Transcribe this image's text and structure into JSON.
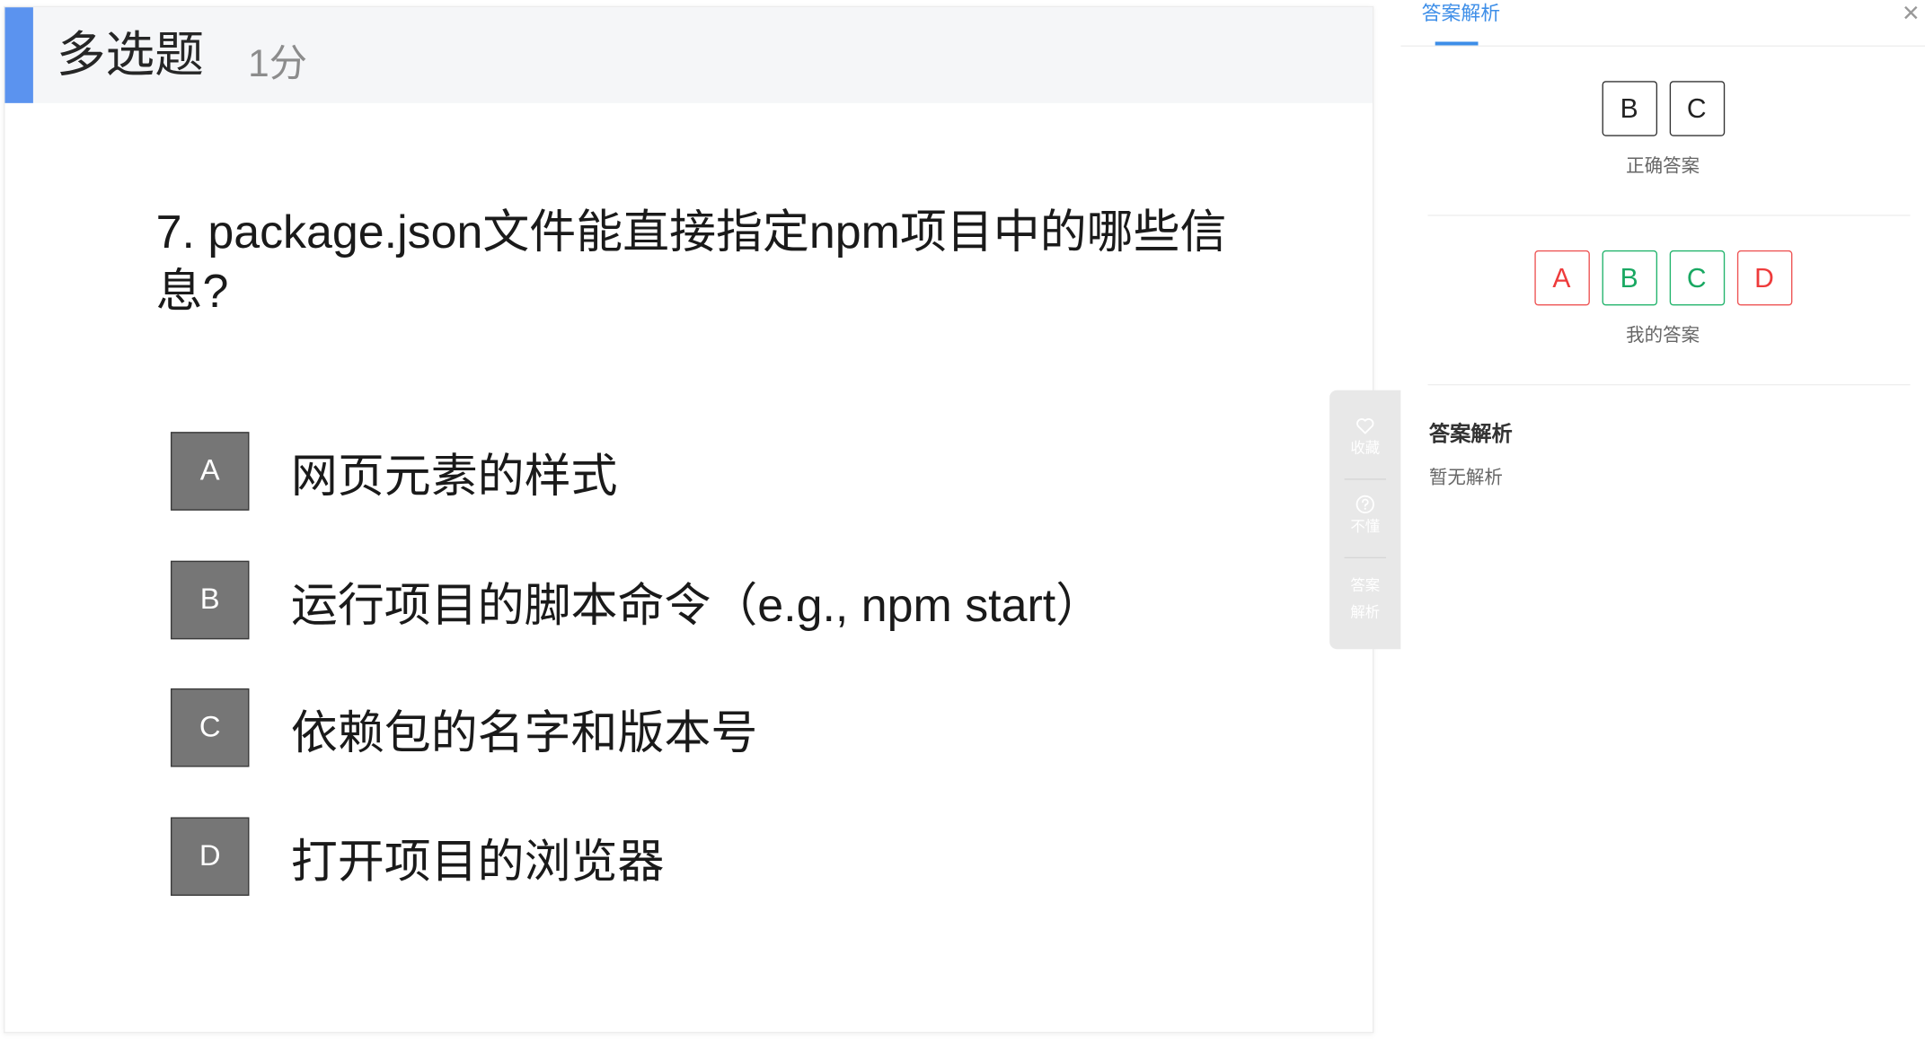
{
  "question": {
    "type_label": "多选题",
    "score": "1分",
    "stem": "7. package.json文件能直接指定npm项目中的哪些信息?",
    "options": [
      {
        "letter": "A",
        "text": "网页元素的样式"
      },
      {
        "letter": "B",
        "text": "运行项目的脚本命令（e.g., npm start）"
      },
      {
        "letter": "C",
        "text": "依赖包的名字和版本号"
      },
      {
        "letter": "D",
        "text": "打开项目的浏览器"
      }
    ]
  },
  "side_tools": {
    "favorite": {
      "label": "收藏",
      "icon": "heart-icon"
    },
    "not_understand": {
      "label": "不懂",
      "icon": "question-icon"
    },
    "analysis": {
      "label_line1": "答案",
      "label_line2": "解析"
    }
  },
  "panel": {
    "tab_label": "答案解析",
    "close_icon": "close-icon",
    "correct_answer": {
      "options": [
        "B",
        "C"
      ],
      "caption": "正确答案"
    },
    "my_answer": {
      "options": [
        {
          "letter": "A",
          "status": "wrong"
        },
        {
          "letter": "B",
          "status": "right"
        },
        {
          "letter": "C",
          "status": "right"
        },
        {
          "letter": "D",
          "status": "wrong"
        }
      ],
      "caption": "我的答案"
    },
    "analysis_title": "答案解析",
    "analysis_body": "暂无解析"
  },
  "colors": {
    "accent_blue": "#5b93ef",
    "tab_blue": "#3d8ee8",
    "correct_green": "#19a862",
    "wrong_red": "#ee3b3b",
    "option_letter_bg": "#767676"
  }
}
